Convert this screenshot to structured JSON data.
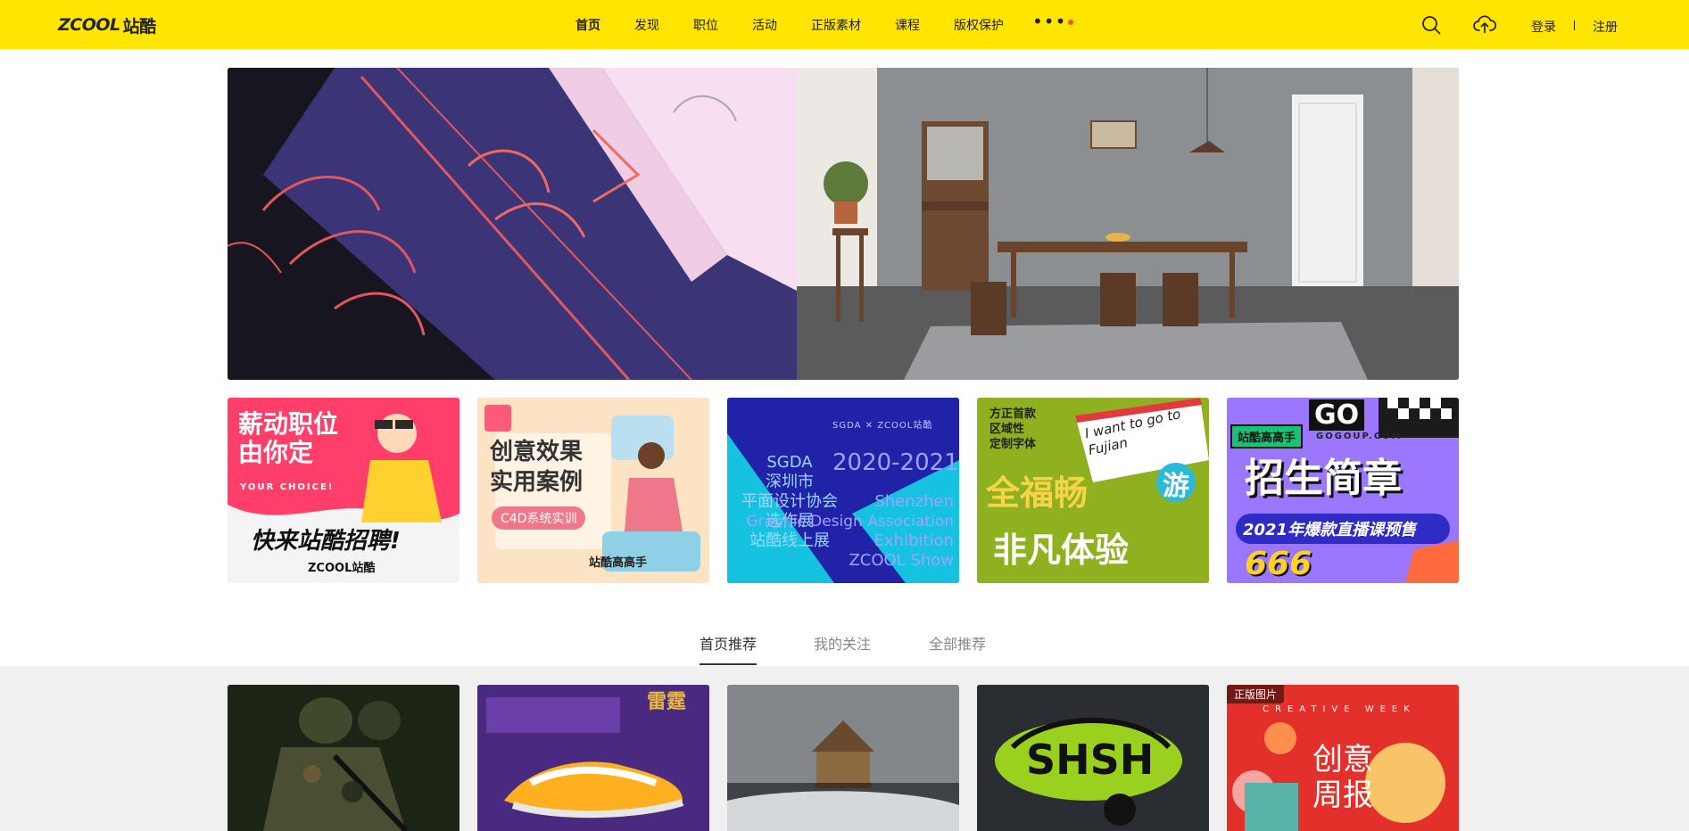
{
  "header": {
    "logo_latin": "ZCOOL",
    "logo_cjk": "站酷",
    "nav": [
      "首页",
      "发现",
      "职位",
      "活动",
      "正版素材",
      "课程",
      "版权保护"
    ],
    "more": "•••",
    "login": "登录",
    "register": "注册",
    "accent_color": "#ffe500"
  },
  "cards": {
    "c1": {
      "title1": "薪动职位",
      "title2": "由你定",
      "sub": "YOUR CHOICE!",
      "cta": "快来站酷招聘!",
      "brand": "ZCOOL站酷"
    },
    "c2": {
      "title1": "创意效果",
      "title2": "实用案例",
      "pill": "C4D系统实训",
      "brand": "站酷高高手"
    },
    "c3": {
      "head": "SGDA ✕ ZCOOL站酷",
      "year": "2020-2021",
      "l1": "SGDA",
      "l2": "深圳市",
      "l3": "平面设计协会",
      "l4": "选作展",
      "l5": "站酷线上展",
      "r1": "Shenzhen",
      "r2": "Graphic Design Association",
      "r3": "Exhibition",
      "r4": "ZCOOL Show"
    },
    "c4": {
      "top": "方正首款\n区域性\n定制字体",
      "postcard": "I want to go to Fujian",
      "big1": "全福畅",
      "big2": "游",
      "big3": "非凡体验"
    },
    "c5": {
      "tag": "站酷高高手",
      "go": "GO",
      "url": "GOGOUP.COM",
      "title": "招生简章",
      "sub": "2021年爆款直播课预售",
      "num": "666"
    }
  },
  "tabs": [
    "首页推荐",
    "我的关注",
    "全部推荐"
  ],
  "works": {
    "badge": "正版图片",
    "w5_title1": "创意",
    "w5_title2": "周报",
    "w5_tag": "CREATIVE WEEK",
    "w2_label": "雷霆"
  },
  "icons": [
    "search-icon",
    "upload-cloud-icon"
  ]
}
